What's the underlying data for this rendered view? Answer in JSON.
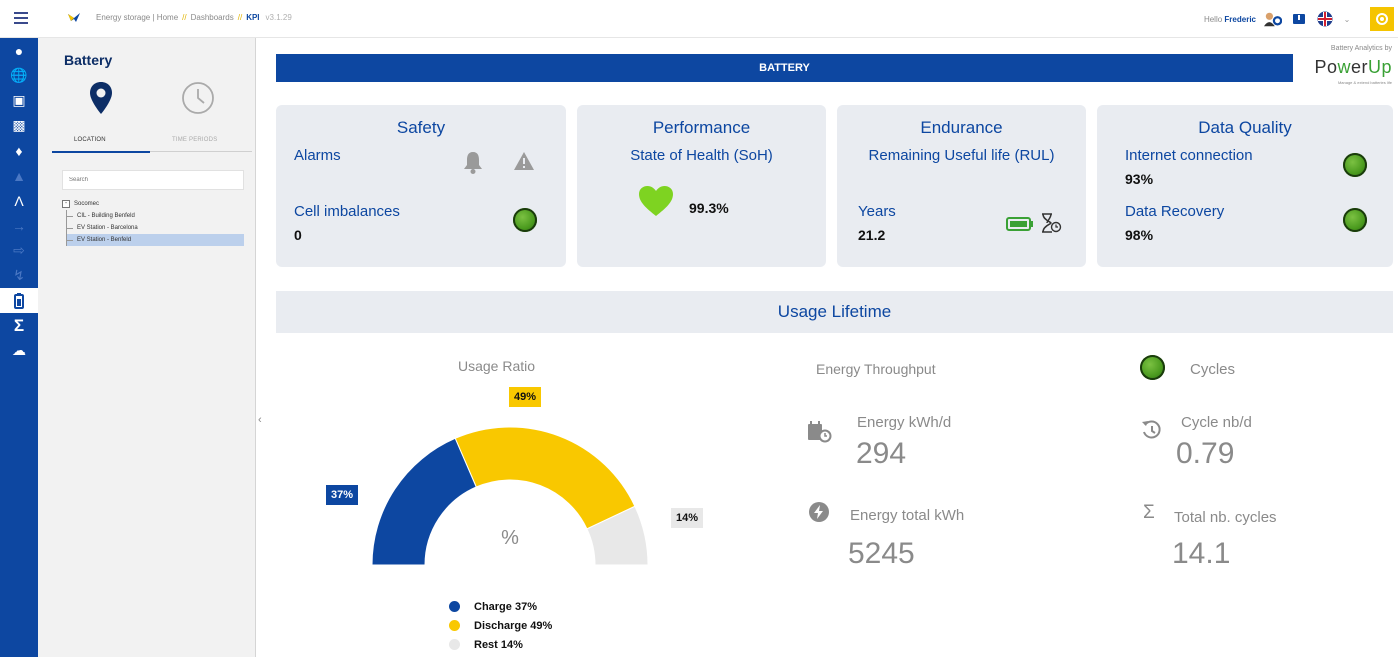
{
  "topbar": {
    "breadcrumb": {
      "app": "Energy storage |",
      "home": "Home",
      "sep1": "//",
      "dashboards": "Dashboards",
      "sep2": "//",
      "kpi": "KPI",
      "version": "v3.1.29"
    },
    "hello": "Hello",
    "user_name": "Frederic",
    "icons": [
      "menu-icon",
      "user-settings-icon",
      "book-icon",
      "uk-flag-icon",
      "settings-gear-icon"
    ]
  },
  "rail": {
    "items": [
      "location-pin-icon",
      "globe-icon",
      "factory-icon",
      "chart-icon",
      "cars-icon",
      "bell-icon",
      "route-icon",
      "login-icon",
      "logout-icon",
      "lightning-icon",
      "battery-icon",
      "sigma-icon",
      "cloud-icon"
    ]
  },
  "panel": {
    "title": "Battery",
    "tab_location": "LOCATION",
    "tab_time": "TIME PERIODS",
    "search_placeholder": "Search",
    "tree": {
      "root": "Socomec",
      "children": [
        "CIL - Building Benfeld",
        "EV Station - Barcelona",
        "EV Station - Benfeld"
      ]
    }
  },
  "header": {
    "title": "BATTERY",
    "branding_top": "Battery Analytics by",
    "branding_logo_a": "Po",
    "branding_logo_w": "w",
    "branding_logo_b": "er",
    "branding_logo_up": "Up",
    "branding_tagline": "Manage & extend batteries life"
  },
  "kpis": {
    "safety": {
      "title": "Safety",
      "alarms_label": "Alarms",
      "cell_label": "Cell imbalances",
      "cell_value": "0"
    },
    "performance": {
      "title": "Performance",
      "soh_label": "State of Health (SoH)",
      "soh_value": "99.3%"
    },
    "endurance": {
      "title": "Endurance",
      "rul_label": "Remaining Useful life (RUL)",
      "years_label": "Years",
      "years_value": "21.2"
    },
    "quality": {
      "title": "Data Quality",
      "internet_label": "Internet connection",
      "internet_value": "93%",
      "recovery_label": "Data Recovery",
      "recovery_value": "98%"
    }
  },
  "usage": {
    "title": "Usage Lifetime",
    "ratio_title": "Usage Ratio",
    "center_symbol": "%",
    "charge_tag": "37%",
    "discharge_tag": "49%",
    "rest_tag": "14%",
    "legend": [
      "Charge 37%",
      "Discharge 49%",
      "Rest 14%"
    ],
    "colors": {
      "charge": "#0d47a1",
      "discharge": "#f9c800",
      "rest": "#e8e8e8"
    },
    "throughput_title": "Energy Throughput",
    "energy_day_label": "Energy kWh/d",
    "energy_day_value": "294",
    "energy_total_label": "Energy total kWh",
    "energy_total_value": "5245",
    "cycles_title": "Cycles",
    "cycle_day_label": "Cycle nb/d",
    "cycle_day_value": "0.79",
    "total_cycles_label": "Total nb. cycles",
    "total_cycles_value": "14.1"
  },
  "chart_data": {
    "type": "pie",
    "title": "Usage Ratio",
    "categories": [
      "Charge",
      "Discharge",
      "Rest"
    ],
    "values": [
      37,
      49,
      14
    ],
    "colors": [
      "#0d47a1",
      "#f9c800",
      "#e8e8e8"
    ],
    "style": "semi-donut"
  }
}
